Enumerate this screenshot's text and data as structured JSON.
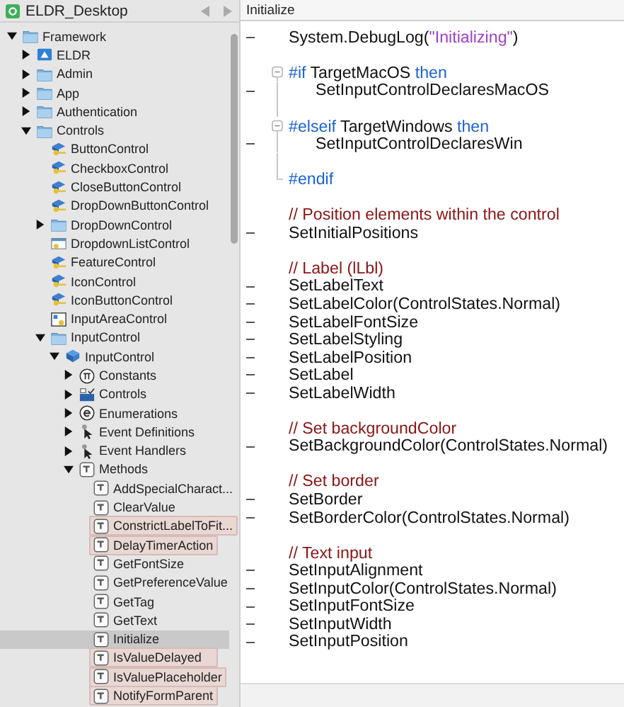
{
  "sidebar": {
    "title": "ELDR_Desktop",
    "tree": [
      {
        "label": "Framework",
        "kind": "folder",
        "expanded": true,
        "selected": false,
        "children": [
          {
            "label": "ELDR",
            "kind": "app",
            "expanded": false,
            "selected": false
          },
          {
            "label": "Admin",
            "kind": "folder",
            "expanded": false,
            "selected": false
          },
          {
            "label": "App",
            "kind": "folder",
            "expanded": false,
            "selected": false
          },
          {
            "label": "Authentication",
            "kind": "folder",
            "expanded": false,
            "selected": false
          },
          {
            "label": "Controls",
            "kind": "folder",
            "expanded": true,
            "selected": false,
            "children": [
              {
                "label": "ButtonControl",
                "kind": "class",
                "selected": false
              },
              {
                "label": "CheckboxControl",
                "kind": "class",
                "selected": false
              },
              {
                "label": "CloseButtonControl",
                "kind": "class",
                "selected": false
              },
              {
                "label": "DropDownButtonControl",
                "kind": "class",
                "selected": false
              },
              {
                "label": "DropDownControl",
                "kind": "folder",
                "expanded": false,
                "selected": false
              },
              {
                "label": "DropdownListControl",
                "kind": "window",
                "selected": false
              },
              {
                "label": "FeatureControl",
                "kind": "class",
                "selected": false
              },
              {
                "label": "IconControl",
                "kind": "class",
                "selected": false
              },
              {
                "label": "IconButtonControl",
                "kind": "class",
                "selected": false
              },
              {
                "label": "InputAreaControl",
                "kind": "container",
                "selected": false
              },
              {
                "label": "InputControl",
                "kind": "folder",
                "expanded": true,
                "selected": false,
                "children": [
                  {
                    "label": "InputControl",
                    "kind": "module",
                    "expanded": true,
                    "selected": false,
                    "children": [
                      {
                        "label": "Constants",
                        "kind": "constants",
                        "expanded": false,
                        "selected": false
                      },
                      {
                        "label": "Controls",
                        "kind": "controls",
                        "expanded": false,
                        "selected": false
                      },
                      {
                        "label": "Enumerations",
                        "kind": "enumerations",
                        "expanded": false,
                        "selected": false
                      },
                      {
                        "label": "Event Definitions",
                        "kind": "event",
                        "expanded": false,
                        "selected": false
                      },
                      {
                        "label": "Event Handlers",
                        "kind": "event",
                        "expanded": false,
                        "selected": false
                      },
                      {
                        "label": "Methods",
                        "kind": "method",
                        "expanded": true,
                        "selected": false,
                        "children": [
                          {
                            "label": "AddSpecialCharact...",
                            "kind": "method",
                            "selected": false,
                            "modified": false
                          },
                          {
                            "label": "ClearValue",
                            "kind": "method",
                            "selected": false,
                            "modified": false
                          },
                          {
                            "label": "ConstrictLabelToFit...",
                            "kind": "method",
                            "selected": false,
                            "modified": true
                          },
                          {
                            "label": "DelayTimerAction",
                            "kind": "method",
                            "selected": false,
                            "modified": true
                          },
                          {
                            "label": "GetFontSize",
                            "kind": "method",
                            "selected": false,
                            "modified": false
                          },
                          {
                            "label": "GetPreferenceValue",
                            "kind": "method",
                            "selected": false,
                            "modified": false
                          },
                          {
                            "label": "GetTag",
                            "kind": "method",
                            "selected": false,
                            "modified": false
                          },
                          {
                            "label": "GetText",
                            "kind": "method",
                            "selected": false,
                            "modified": false
                          },
                          {
                            "label": "Initialize",
                            "kind": "method",
                            "selected": true,
                            "modified": false
                          },
                          {
                            "label": "IsValueDelayed",
                            "kind": "method",
                            "selected": false,
                            "modified": true
                          },
                          {
                            "label": "IsValuePlaceholder",
                            "kind": "method",
                            "selected": false,
                            "modified": true
                          },
                          {
                            "label": "NotifyFormParent",
                            "kind": "method",
                            "selected": false,
                            "modified": true
                          }
                        ]
                      }
                    ]
                  }
                ]
              }
            ]
          }
        ]
      }
    ]
  },
  "editor": {
    "tab": "Initialize",
    "lines": [
      {
        "kind": "code",
        "executable": true,
        "tokens": [
          {
            "kind": "plain",
            "text": "System.DebugLog("
          },
          {
            "kind": "string",
            "text": "\"Initializing\""
          },
          {
            "kind": "plain",
            "text": ")"
          }
        ]
      },
      {
        "kind": "blank"
      },
      {
        "kind": "fold-start",
        "tokens": [
          {
            "kind": "keyword",
            "text": "#if"
          },
          {
            "kind": "plain",
            "text": " TargetMacOS "
          },
          {
            "kind": "keyword",
            "text": "then"
          }
        ]
      },
      {
        "kind": "fold-code",
        "executable": true,
        "tokens": [
          {
            "kind": "plain",
            "text": "SetInputControlDeclaresMacOS"
          }
        ]
      },
      {
        "kind": "fold-blank"
      },
      {
        "kind": "fold-start",
        "tokens": [
          {
            "kind": "keyword",
            "text": "#elseif"
          },
          {
            "kind": "plain",
            "text": " TargetWindows "
          },
          {
            "kind": "keyword",
            "text": "then"
          }
        ]
      },
      {
        "kind": "fold-code",
        "executable": true,
        "tokens": [
          {
            "kind": "plain",
            "text": "SetInputControlDeclaresWin"
          }
        ]
      },
      {
        "kind": "fold-blank"
      },
      {
        "kind": "fold-end",
        "tokens": [
          {
            "kind": "keyword",
            "text": "#endif"
          }
        ]
      },
      {
        "kind": "blank"
      },
      {
        "kind": "code",
        "tokens": [
          {
            "kind": "comment",
            "text": "// Position elements within the control"
          }
        ]
      },
      {
        "kind": "code",
        "executable": true,
        "tokens": [
          {
            "kind": "plain",
            "text": "SetInitialPositions"
          }
        ]
      },
      {
        "kind": "blank"
      },
      {
        "kind": "code",
        "tokens": [
          {
            "kind": "comment",
            "text": "// Label (lLbl)"
          }
        ]
      },
      {
        "kind": "code",
        "executable": true,
        "tokens": [
          {
            "kind": "plain",
            "text": "SetLabelText"
          }
        ]
      },
      {
        "kind": "code",
        "executable": true,
        "tokens": [
          {
            "kind": "plain",
            "text": "SetLabelColor(ControlStates.Normal)"
          }
        ]
      },
      {
        "kind": "code",
        "executable": true,
        "tokens": [
          {
            "kind": "plain",
            "text": "SetLabelFontSize"
          }
        ]
      },
      {
        "kind": "code",
        "executable": true,
        "tokens": [
          {
            "kind": "plain",
            "text": "SetLabelStyling"
          }
        ]
      },
      {
        "kind": "code",
        "executable": true,
        "tokens": [
          {
            "kind": "plain",
            "text": "SetLabelPosition"
          }
        ]
      },
      {
        "kind": "code",
        "executable": true,
        "tokens": [
          {
            "kind": "plain",
            "text": "SetLabel"
          }
        ]
      },
      {
        "kind": "code",
        "executable": true,
        "tokens": [
          {
            "kind": "plain",
            "text": "SetLabelWidth"
          }
        ]
      },
      {
        "kind": "blank"
      },
      {
        "kind": "code",
        "tokens": [
          {
            "kind": "comment",
            "text": "// Set backgroundColor"
          }
        ]
      },
      {
        "kind": "code",
        "executable": true,
        "tokens": [
          {
            "kind": "plain",
            "text": "SetBackgroundColor(ControlStates.Normal)"
          }
        ]
      },
      {
        "kind": "blank"
      },
      {
        "kind": "code",
        "tokens": [
          {
            "kind": "comment",
            "text": "// Set border"
          }
        ]
      },
      {
        "kind": "code",
        "executable": true,
        "tokens": [
          {
            "kind": "plain",
            "text": "SetBorder"
          }
        ]
      },
      {
        "kind": "code",
        "executable": true,
        "tokens": [
          {
            "kind": "plain",
            "text": "SetBorderColor(ControlStates.Normal)"
          }
        ]
      },
      {
        "kind": "blank"
      },
      {
        "kind": "code",
        "tokens": [
          {
            "kind": "comment",
            "text": "// Text input"
          }
        ]
      },
      {
        "kind": "code",
        "executable": true,
        "tokens": [
          {
            "kind": "plain",
            "text": "SetInputAlignment"
          }
        ]
      },
      {
        "kind": "code",
        "executable": true,
        "tokens": [
          {
            "kind": "plain",
            "text": "SetInputColor(ControlStates.Normal)"
          }
        ]
      },
      {
        "kind": "code",
        "executable": true,
        "tokens": [
          {
            "kind": "plain",
            "text": "SetInputFontSize"
          }
        ]
      },
      {
        "kind": "code",
        "executable": true,
        "tokens": [
          {
            "kind": "plain",
            "text": "SetInputWidth"
          }
        ]
      },
      {
        "kind": "code",
        "executable": true,
        "tokens": [
          {
            "kind": "plain",
            "text": "SetInputPosition"
          }
        ]
      }
    ]
  }
}
